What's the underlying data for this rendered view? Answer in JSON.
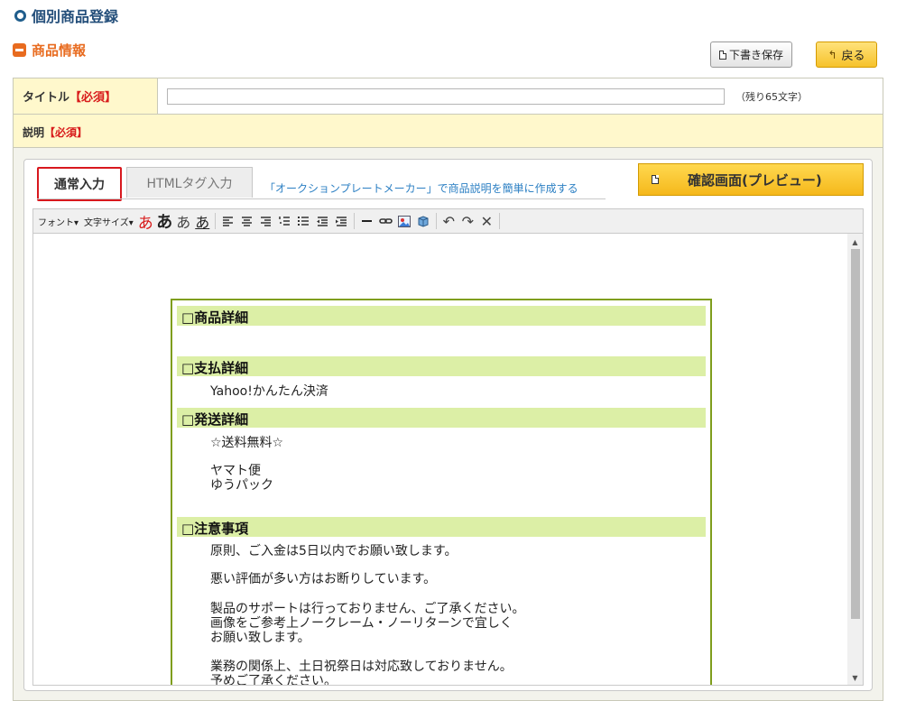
{
  "page": {
    "title": "個別商品登録"
  },
  "section": {
    "title": "商品情報"
  },
  "actions": {
    "draft_label": "下書き保存",
    "back_label": "戻る"
  },
  "form": {
    "title_label": "タイトル",
    "required_tag": "【必須】",
    "title_value": "",
    "remaining": "（残り65文字）",
    "desc_label": "説明"
  },
  "editor": {
    "tabs": {
      "normal": "通常入力",
      "html": "HTMLタグ入力"
    },
    "maker_link": "「オークションプレートメーカー」で商品説明を簡単に作成する",
    "preview_label": "確認画面(プレビュー)",
    "toolbar": {
      "font": "フォント▾",
      "size": "文字サイズ▾",
      "glyph": "あ"
    },
    "content": {
      "sections": [
        {
          "heading": "□商品詳細",
          "lines": []
        },
        {
          "heading": "□支払詳細",
          "lines": [
            "Yahoo!かんたん決済"
          ]
        },
        {
          "heading": "□発送詳細",
          "lines": [
            "☆送料無料☆",
            "",
            "ヤマト便",
            "ゆうパック"
          ]
        },
        {
          "heading": "□注意事項",
          "lines": [
            "原則、ご入金は5日以内でお願い致します。",
            "悪い評価が多い方はお断りしています。",
            "製品のサポートは行っておりません、ご了承ください。",
            "画像をご参考上ノークレーム・ノーリターンで宜しく",
            "お願い致します。",
            "業務の関係上、土日祝祭日は対応致しておりません。",
            "予めご了承ください。"
          ]
        }
      ]
    }
  }
}
